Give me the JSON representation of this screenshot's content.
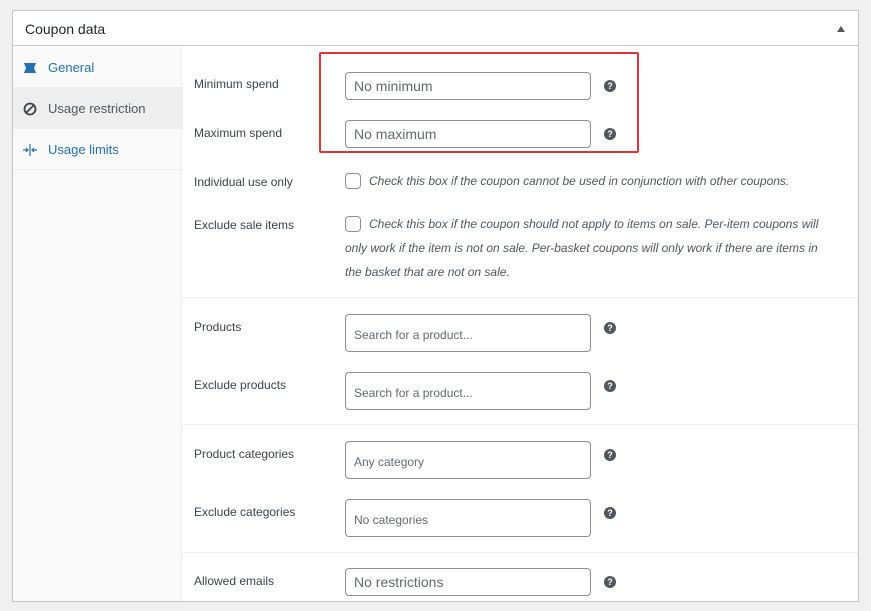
{
  "panel": {
    "title": "Coupon data"
  },
  "tabs": [
    {
      "label": "General",
      "icon": "ticket-icon"
    },
    {
      "label": "Usage restriction",
      "icon": "no-entry-icon"
    },
    {
      "label": "Usage limits",
      "icon": "arrows-icon"
    }
  ],
  "fields": {
    "minimum_spend": {
      "label": "Minimum spend",
      "placeholder": "No minimum"
    },
    "maximum_spend": {
      "label": "Maximum spend",
      "placeholder": "No maximum"
    },
    "individual_use": {
      "label": "Individual use only",
      "description": "Check this box if the coupon cannot be used in conjunction with other coupons."
    },
    "exclude_sale": {
      "label": "Exclude sale items",
      "description": "Check this box if the coupon should not apply to items on sale. Per-item coupons will only work if the item is not on sale. Per-basket coupons will only work if there are items in the basket that are not on sale."
    },
    "products": {
      "label": "Products",
      "placeholder": "Search for a product..."
    },
    "exclude_products": {
      "label": "Exclude products",
      "placeholder": "Search for a product..."
    },
    "product_categories": {
      "label": "Product categories",
      "placeholder": "Any category"
    },
    "exclude_categories": {
      "label": "Exclude categories",
      "placeholder": "No categories"
    },
    "allowed_emails": {
      "label": "Allowed emails",
      "placeholder": "No restrictions"
    }
  },
  "help_glyph": "?",
  "colors": {
    "accent": "#2271b1",
    "highlight": "#e0343a"
  }
}
